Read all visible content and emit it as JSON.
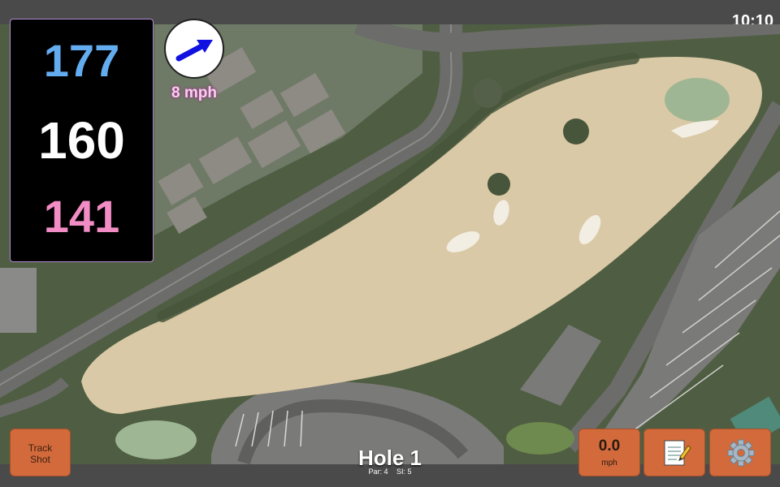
{
  "status_bar": {
    "time": "10:10"
  },
  "distances": {
    "back": "177",
    "middle": "160",
    "front": "141",
    "colors": {
      "back": "#64acf0",
      "middle": "#ffffff",
      "front": "#f28cc4"
    }
  },
  "wind": {
    "speed_text": "8 mph",
    "arrow_icon": "wind-direction-arrow-icon"
  },
  "buttons": {
    "track_shot_line1": "Track",
    "track_shot_line2": "Shot",
    "speed_value": "0.0",
    "speed_unit": "mph",
    "notes_icon": "notepad-icon",
    "settings_icon": "gear-icon"
  },
  "hole": {
    "title": "Hole 1",
    "par_label": "Par: 4",
    "si_label": "SI: 5"
  },
  "colors": {
    "button": "#d26a3c",
    "fairway": "#d9c9a6",
    "green": "#9fb694",
    "bunker": "#f3eee3"
  }
}
